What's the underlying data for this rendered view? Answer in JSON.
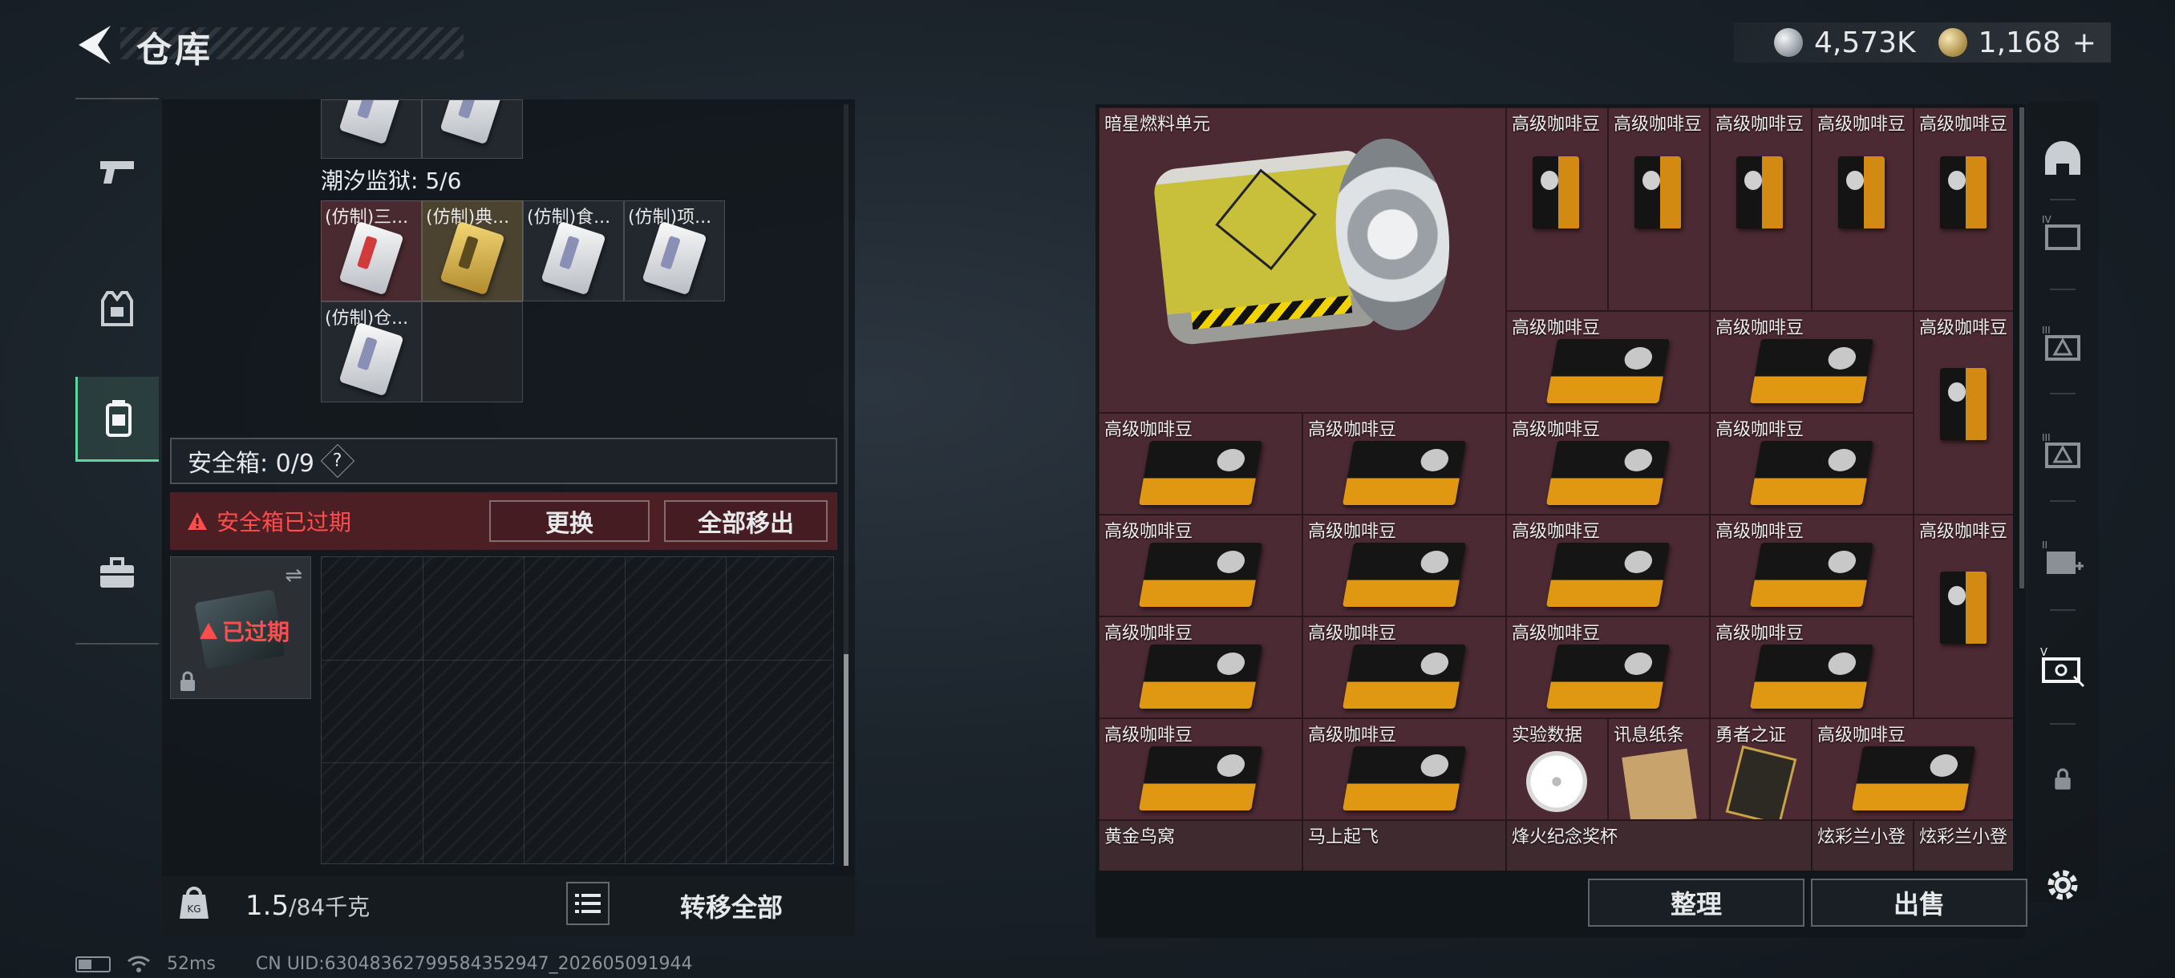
{
  "header": {
    "title": "仓库",
    "currencies": [
      {
        "icon": "silver-coin-icon",
        "value": "4,573K"
      },
      {
        "icon": "gold-coin-icon",
        "value": "1,168"
      }
    ],
    "add_label": "+"
  },
  "left_rail": [
    {
      "icon": "pistol-icon"
    },
    {
      "icon": "armor-vest-icon"
    },
    {
      "icon": "backpack-icon",
      "active": true
    },
    {
      "icon": "toolbox-icon"
    }
  ],
  "storage": {
    "section_title": "潮汐监狱: 5/6",
    "items": [
      {
        "label": "(仿制)三..."
      },
      {
        "label": "(仿制)典..."
      },
      {
        "label": "(仿制)食..."
      },
      {
        "label": "(仿制)项..."
      },
      {
        "label": "(仿制)仓..."
      }
    ]
  },
  "safebox": {
    "label": "安全箱: 0/9",
    "help": "?",
    "expired_warning": "安全箱已过期",
    "replace_button": "更换",
    "remove_all_button": "全部移出",
    "thumb_expired": "已过期"
  },
  "left_bottom": {
    "weight_value": "1.5",
    "weight_capacity": "/84千克",
    "transfer_all": "转移全部"
  },
  "status": {
    "ping": "52ms",
    "uid": "CN UID:63048362799584352947_202605091944"
  },
  "warehouse": {
    "items": [
      {
        "name": "暗星燃料单元"
      },
      {
        "name": "高级咖啡豆"
      },
      {
        "name": "实验数据"
      },
      {
        "name": "讯息纸条"
      },
      {
        "name": "勇者之证"
      },
      {
        "name": "黄金鸟窝"
      },
      {
        "name": "马上起飞"
      },
      {
        "name": "烽火纪念奖杯"
      },
      {
        "name": "炫彩兰小登"
      }
    ],
    "sort_button": "整理",
    "sell_button": "出售"
  },
  "right_rail": [
    {
      "icon": "helmet-icon"
    },
    {
      "icon": "tier-iv-box-icon"
    },
    {
      "icon": "tier-iii-box-icon"
    },
    {
      "icon": "tier-iii-box-alt-icon"
    },
    {
      "icon": "tier-ii-add-icon"
    },
    {
      "icon": "tier-v-ticket-icon"
    },
    {
      "icon": "lock-icon"
    },
    {
      "icon": "gear-icon"
    }
  ]
}
